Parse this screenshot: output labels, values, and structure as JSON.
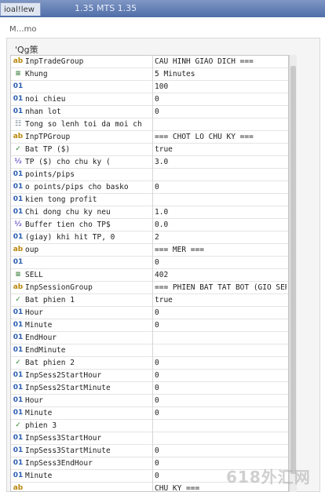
{
  "window": {
    "tab_label": "ioal!lew",
    "title": "1.35 MTS 1.35"
  },
  "infobar": {
    "label": "M…mo"
  },
  "panel": {
    "header": "'Qg策"
  },
  "rows": [
    {
      "icon": "ab",
      "icon_type": "abc",
      "name": "InpTradeGroup",
      "value": "CAU HINH GIAO DICH ==="
    },
    {
      "icon": "≡",
      "icon_type": "enum",
      "name": "Khung",
      "value": "5 Minutes"
    },
    {
      "icon": "01",
      "icon_type": "num",
      "name": "",
      "value": "100"
    },
    {
      "icon": "01",
      "icon_type": "num",
      "name": "noi chieu",
      "value": "0"
    },
    {
      "icon": "01",
      "icon_type": "num",
      "name": "nhan lot",
      "value": "0"
    },
    {
      "icon": "☷",
      "icon_type": "list",
      "name": "Tong so lenh toi da moi ch",
      "value": ""
    },
    {
      "icon": "ab",
      "icon_type": "abc",
      "name": "InpTPGroup",
      "value": "=== CHOT LO CHU KY ==="
    },
    {
      "icon": "✓",
      "icon_type": "bool",
      "name": "Bat TP ($)",
      "value": "true"
    },
    {
      "icon": "½",
      "icon_type": "half",
      "name": "TP ($) cho chu ky (",
      "value": "3.0"
    },
    {
      "icon": "01",
      "icon_type": "num",
      "name": "points/pips",
      "value": ""
    },
    {
      "icon": "01",
      "icon_type": "num",
      "name": "o points/pips cho basko",
      "value": "0"
    },
    {
      "icon": "01",
      "icon_type": "num",
      "name": "kien tong profit",
      "value": ""
    },
    {
      "icon": "01",
      "icon_type": "num",
      "name": "Chi dong chu ky neu",
      "value": "1.0"
    },
    {
      "icon": "½",
      "icon_type": "half",
      "name": "Buffer tien cho TP$",
      "value": "0.0"
    },
    {
      "icon": "01",
      "icon_type": "num",
      "name": "(giay) khi hit TP, 0",
      "value": "2"
    },
    {
      "icon": "ab",
      "icon_type": "abc",
      "name": "oup",
      "value": "=== MER ==="
    },
    {
      "icon": "01",
      "icon_type": "num",
      "name": "",
      "value": "0"
    },
    {
      "icon": "≡",
      "icon_type": "enum",
      "name": "SELL",
      "value": "402"
    },
    {
      "icon": "ab",
      "icon_type": "abc",
      "name": "InpSessionGroup",
      "value": "=== PHIEN BAT TAT BOT (GIO SERV"
    },
    {
      "icon": "✓",
      "icon_type": "bool",
      "name": "Bat phien 1",
      "value": "true"
    },
    {
      "icon": "01",
      "icon_type": "num",
      "name": "Hour",
      "value": "0"
    },
    {
      "icon": "01",
      "icon_type": "num",
      "name": "Minute",
      "value": "0"
    },
    {
      "icon": "01",
      "icon_type": "num",
      "name": "EndHour",
      "value": ""
    },
    {
      "icon": "01",
      "icon_type": "num",
      "name": "EndMinute",
      "value": ""
    },
    {
      "icon": "✓",
      "icon_type": "bool",
      "name": "Bat phien 2",
      "value": "0"
    },
    {
      "icon": "01",
      "icon_type": "num",
      "name": "InpSess2StartHour",
      "value": "0"
    },
    {
      "icon": "01",
      "icon_type": "num",
      "name": "InpSess2StartMinute",
      "value": "0"
    },
    {
      "icon": "01",
      "icon_type": "num",
      "name": "Hour",
      "value": "0"
    },
    {
      "icon": "01",
      "icon_type": "num",
      "name": "Minute",
      "value": "0"
    },
    {
      "icon": "✓",
      "icon_type": "bool",
      "name": "phien 3",
      "value": ""
    },
    {
      "icon": "01",
      "icon_type": "num",
      "name": "InpSess3StartHour",
      "value": ""
    },
    {
      "icon": "01",
      "icon_type": "num",
      "name": "InpSess3StartMinute",
      "value": "0"
    },
    {
      "icon": "01",
      "icon_type": "num",
      "name": "InpSess3EndHour",
      "value": "0"
    },
    {
      "icon": "01",
      "icon_type": "num",
      "name": "Minute",
      "value": "0"
    },
    {
      "icon": "ab",
      "icon_type": "abc",
      "name": "",
      "value": "CHU KY ==="
    }
  ],
  "watermark": "618外汇网"
}
